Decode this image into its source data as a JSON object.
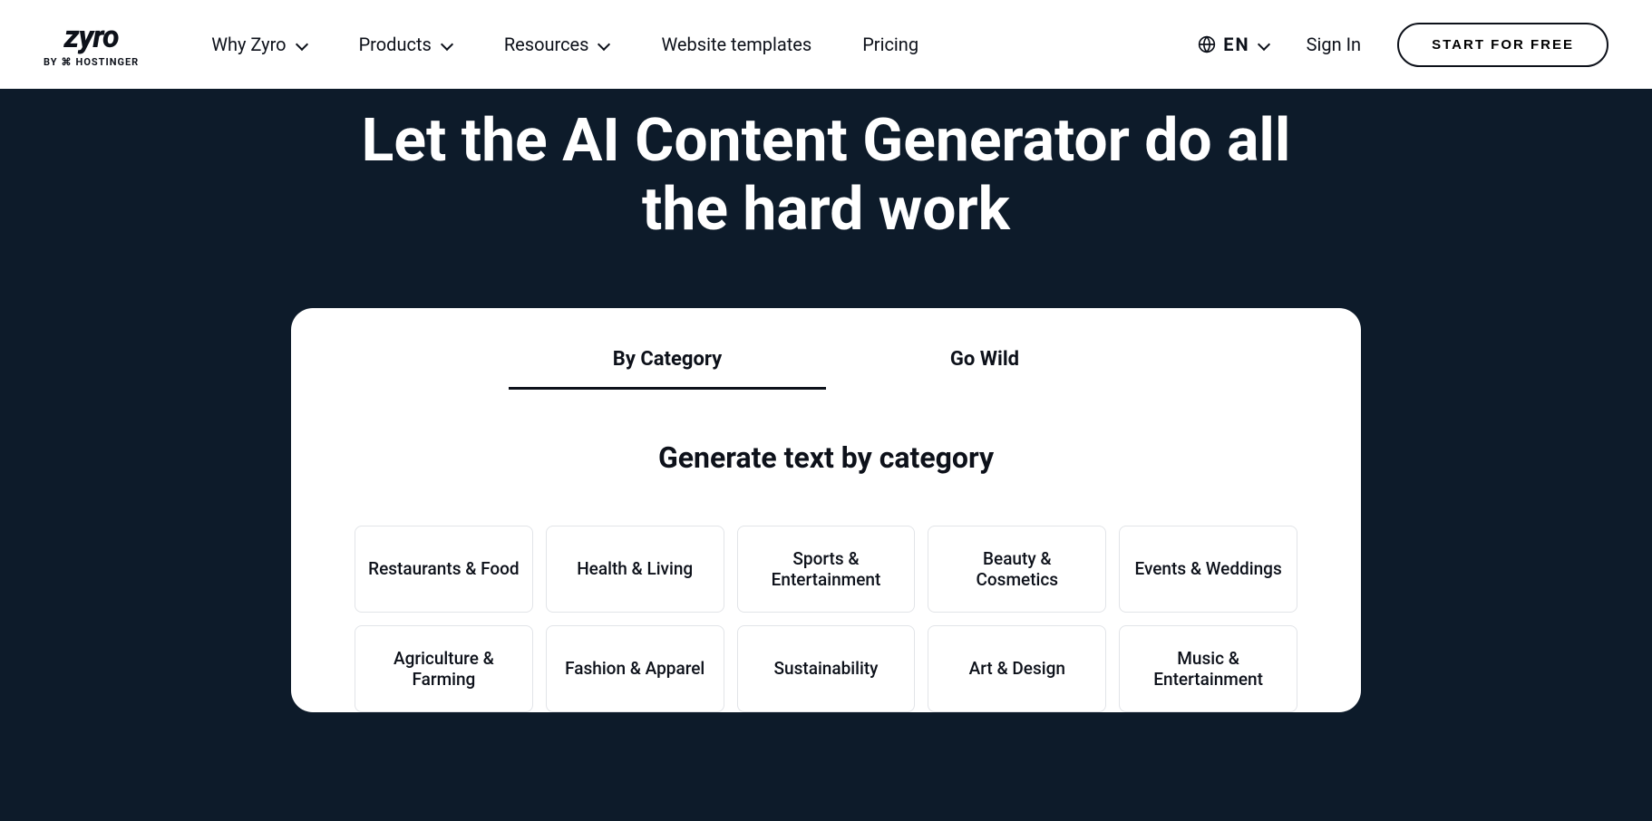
{
  "header": {
    "logo_main": "zyro",
    "logo_sub_prefix": "BY",
    "logo_sub_brand": "HOSTINGER",
    "nav": [
      {
        "label": "Why Zyro",
        "dropdown": true
      },
      {
        "label": "Products",
        "dropdown": true
      },
      {
        "label": "Resources",
        "dropdown": true
      },
      {
        "label": "Website templates",
        "dropdown": false
      },
      {
        "label": "Pricing",
        "dropdown": false
      }
    ],
    "language": "EN",
    "signin": "Sign In",
    "cta": "START FOR FREE"
  },
  "hero": {
    "title": "Let the AI Content Generator do all the hard work"
  },
  "main": {
    "tabs": [
      {
        "label": "By Category",
        "active": true
      },
      {
        "label": "Go Wild",
        "active": false
      }
    ],
    "section_title": "Generate text by category",
    "categories": [
      "Restaurants & Food",
      "Health & Living",
      "Sports & Entertainment",
      "Beauty & Cosmetics",
      "Events & Weddings",
      "Agriculture & Farming",
      "Fashion & Apparel",
      "Sustainability",
      "Art & Design",
      "Music & Entertainment"
    ]
  }
}
